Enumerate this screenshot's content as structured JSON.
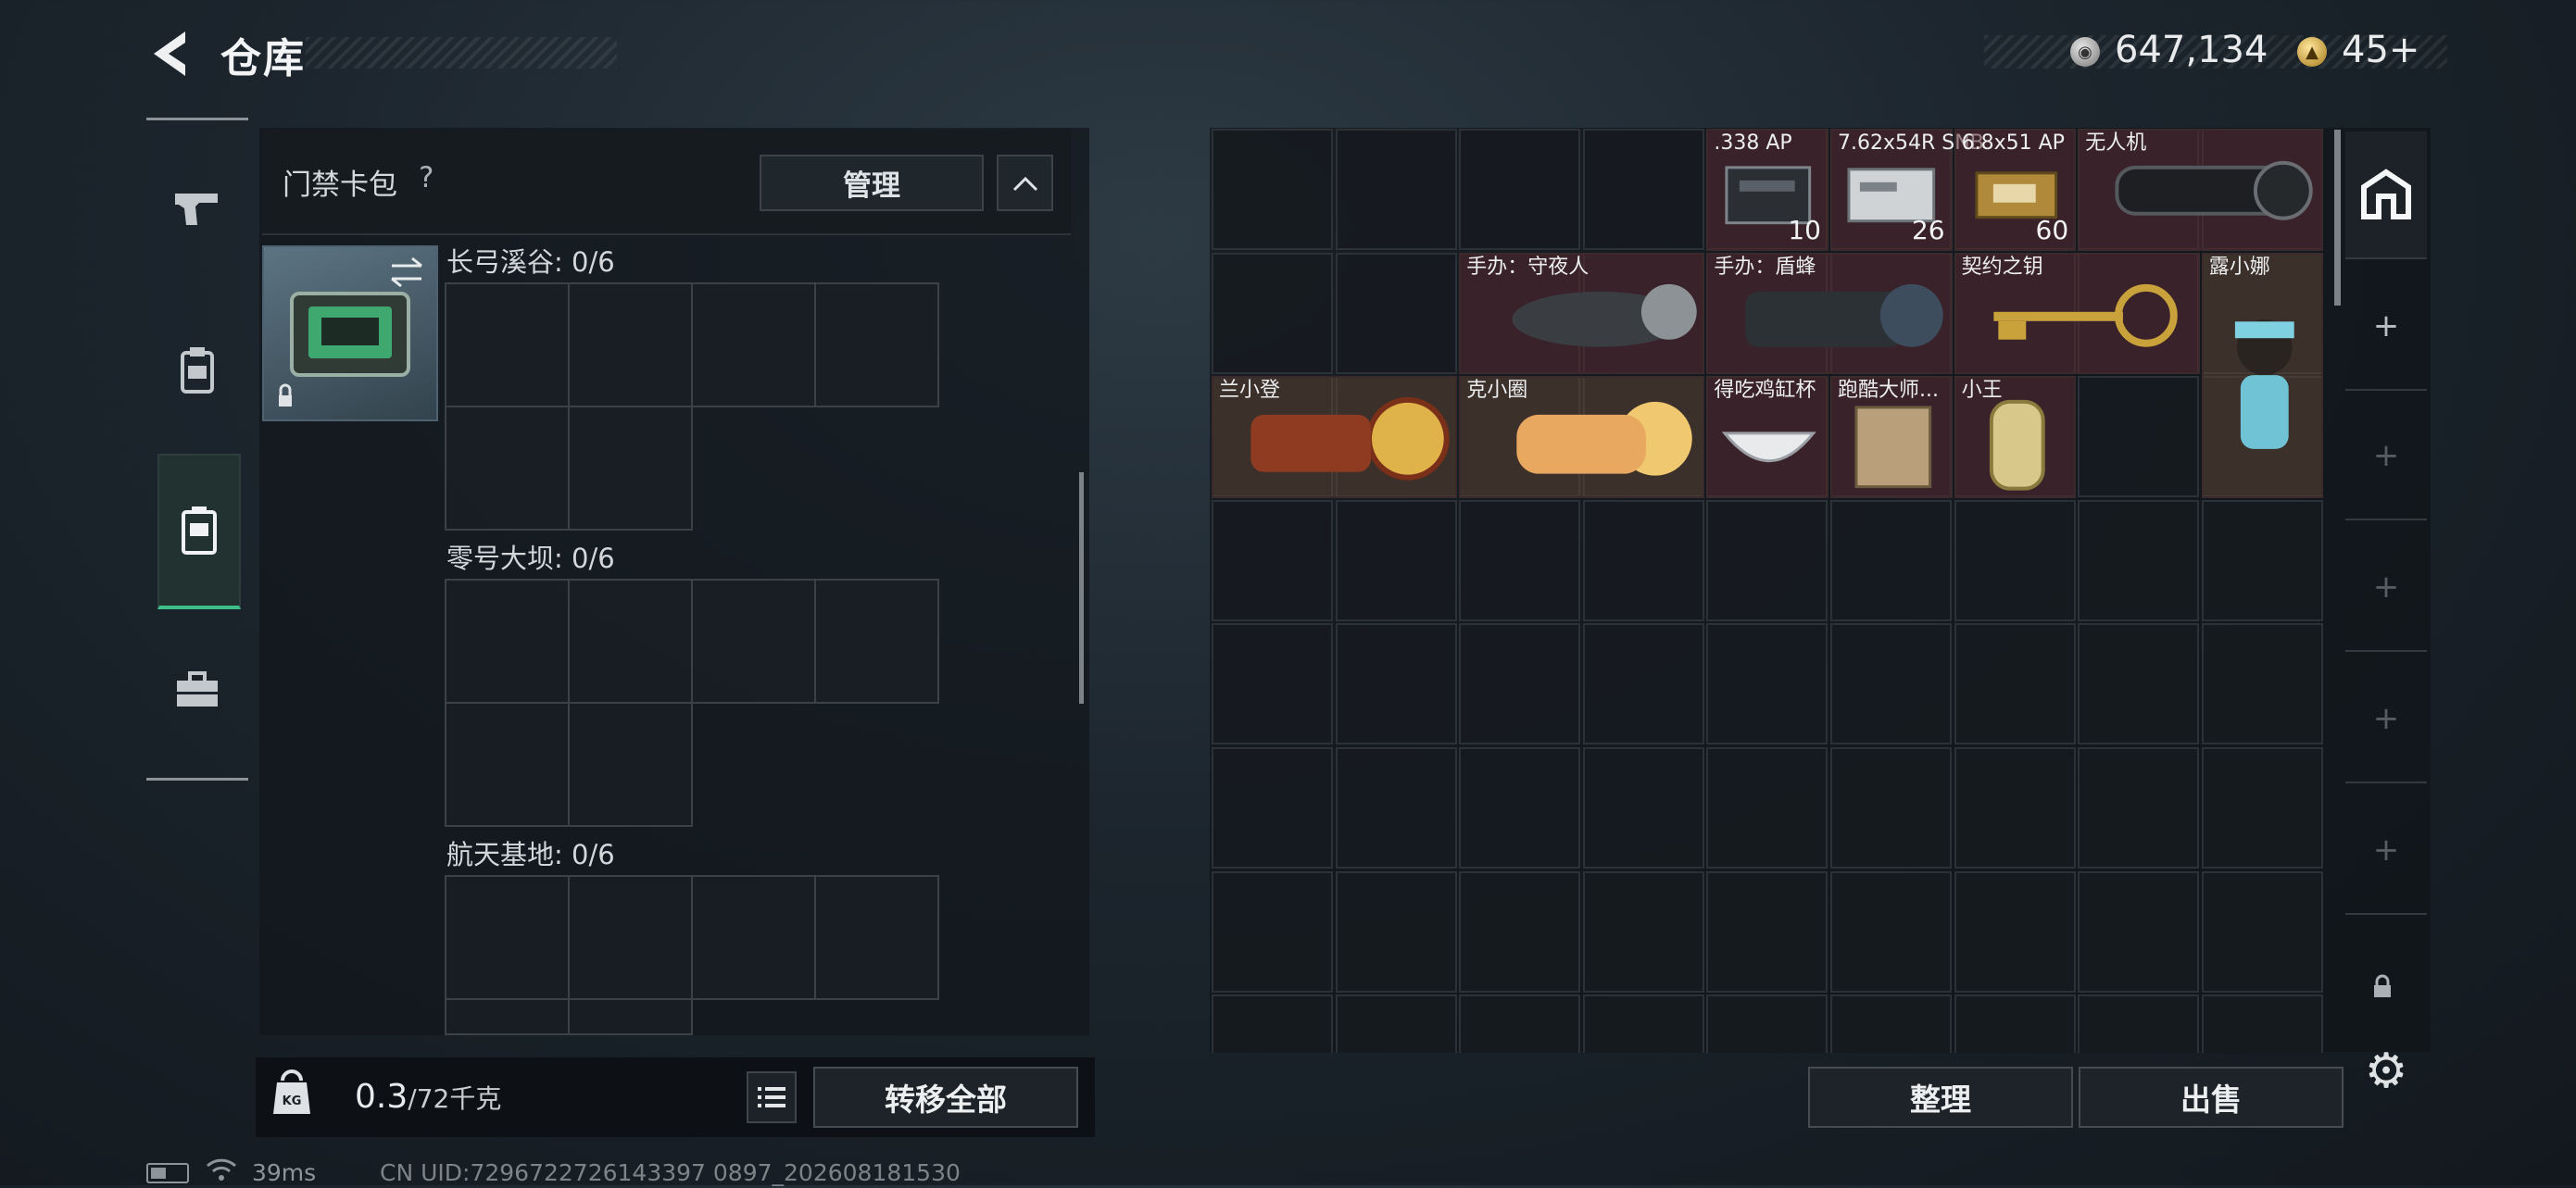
{
  "header": {
    "title": "仓库",
    "currency_silver": "647,134",
    "currency_gold": "45+"
  },
  "sidenav": {
    "items": [
      "pistol-icon",
      "armor-rig-icon",
      "backpack-icon",
      "toolbox-icon"
    ],
    "active_index": 2
  },
  "left_panel": {
    "container_title": "门禁卡包",
    "help": "?",
    "manage_label": "管理",
    "sections": [
      {
        "label": "长弓溪谷: 0/6"
      },
      {
        "label": "零号大坝: 0/6"
      },
      {
        "label": "航天基地: 0/6"
      }
    ],
    "weight_value": "0.3",
    "weight_capacity": "/72千克",
    "kg_icon_text": "KG",
    "transfer_all_label": "转移全部"
  },
  "stash": {
    "items": [
      {
        "name": ".338 AP",
        "count": "10"
      },
      {
        "name": "7.62x54R SNB",
        "count": "26"
      },
      {
        "name": "6.8x51 AP",
        "count": "60"
      },
      {
        "name": "无人机",
        "count": ""
      },
      {
        "name": "手办：守夜人",
        "count": ""
      },
      {
        "name": "手办：盾蜂",
        "count": ""
      },
      {
        "name": "契约之钥",
        "count": ""
      },
      {
        "name": "露小娜",
        "count": ""
      },
      {
        "name": "兰小登",
        "count": ""
      },
      {
        "name": "克小圈",
        "count": ""
      },
      {
        "name": "得吃鸡缸杯",
        "count": ""
      },
      {
        "name": "跑酷大师...",
        "count": ""
      },
      {
        "name": "小王",
        "count": ""
      }
    ],
    "tidy_label": "整理",
    "sell_label": "出售"
  },
  "right_nav": {
    "add_symbol": "+",
    "items": [
      "safe-box-icon",
      "add-slot",
      "add-slot",
      "add-slot",
      "add-slot",
      "add-slot",
      "lock-icon"
    ]
  },
  "status": {
    "ping": "39ms",
    "uid": "CN UID:7296722726143397 0897_202608181530"
  }
}
